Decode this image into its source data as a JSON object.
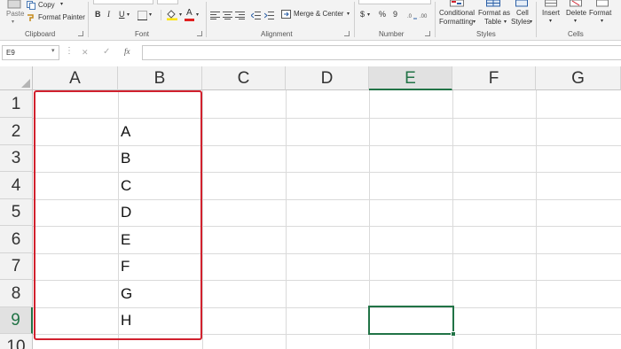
{
  "ribbon": {
    "clipboard": {
      "paste_label": "Paste",
      "copy_label": "Copy",
      "format_painter_label": "Format Painter",
      "group_label": "Clipboard"
    },
    "font": {
      "bold_label": "B",
      "italic_label": "I",
      "underline_label": "U",
      "font_color_label": "A",
      "group_label": "Font"
    },
    "alignment": {
      "merge_center_label": "Merge & Center",
      "group_label": "Alignment"
    },
    "number": {
      "currency_label": "$",
      "percent_label": "%",
      "comma_label": "9",
      "group_label": "Number"
    },
    "styles": {
      "conditional_formatting_line1": "Conditional",
      "conditional_formatting_line2": "Formatting",
      "format_as_table_line1": "Format as",
      "format_as_table_line2": "Table",
      "cell_styles_line1": "Cell",
      "cell_styles_line2": "Styles",
      "group_label": "Styles"
    },
    "cells": {
      "insert_label": "Insert",
      "delete_label": "Delete",
      "format_label": "Format",
      "group_label": "Cells"
    }
  },
  "formula_bar": {
    "name_box": "E9",
    "cancel_symbol": "✕",
    "enter_symbol": "✓",
    "fx_symbol": "fx",
    "formula_value": ""
  },
  "sheet": {
    "columns": [
      "A",
      "B",
      "C",
      "D",
      "E",
      "F",
      "G"
    ],
    "rows": [
      "1",
      "2",
      "3",
      "4",
      "5",
      "6",
      "7",
      "8",
      "9",
      "10"
    ],
    "selected_column": "E",
    "selected_row": "9",
    "cells": {
      "B2": "A",
      "B3": "B",
      "B4": "C",
      "B5": "D",
      "B6": "E",
      "B7": "F",
      "B8": "G",
      "B9": "H"
    },
    "highlight_color": "#d1212e",
    "selection_color": "#217346"
  }
}
